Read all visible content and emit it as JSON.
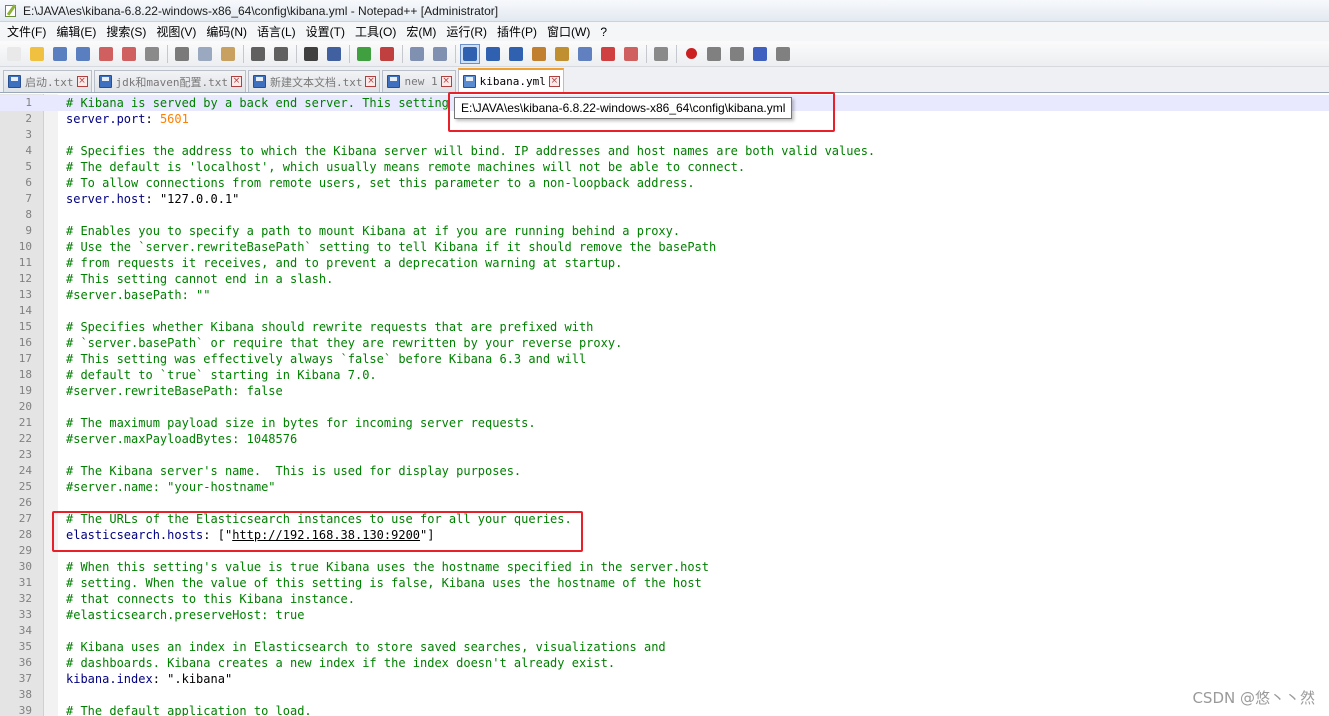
{
  "window": {
    "title": "E:\\JAVA\\es\\kibana-6.8.22-windows-x86_64\\config\\kibana.yml - Notepad++ [Administrator]"
  },
  "menu": [
    "文件(F)",
    "编辑(E)",
    "搜索(S)",
    "视图(V)",
    "编码(N)",
    "语言(L)",
    "设置(T)",
    "工具(O)",
    "宏(M)",
    "运行(R)",
    "插件(P)",
    "窗口(W)",
    "?"
  ],
  "toolbar_icons": [
    {
      "name": "new-file-icon",
      "color": "#e9e9e9"
    },
    {
      "name": "open-file-icon",
      "color": "#f0c040"
    },
    {
      "name": "save-icon",
      "color": "#5a7fc0"
    },
    {
      "name": "save-all-icon",
      "color": "#5a7fc0"
    },
    {
      "name": "close-icon",
      "color": "#d06060"
    },
    {
      "name": "close-all-icon",
      "color": "#d06060"
    },
    {
      "name": "print-icon",
      "color": "#8a8a8a"
    },
    {
      "name": "cut-icon",
      "color": "#7a7a7a"
    },
    {
      "name": "copy-icon",
      "color": "#9aa8c0"
    },
    {
      "name": "paste-icon",
      "color": "#c8a060"
    },
    {
      "name": "undo-icon",
      "color": "#606060"
    },
    {
      "name": "redo-icon",
      "color": "#606060"
    },
    {
      "name": "find-icon",
      "color": "#404040"
    },
    {
      "name": "replace-icon",
      "color": "#4060a0"
    },
    {
      "name": "zoom-in-icon",
      "color": "#40a040"
    },
    {
      "name": "zoom-out-icon",
      "color": "#c04040"
    },
    {
      "name": "sync-vertical-icon",
      "color": "#8090b0"
    },
    {
      "name": "sync-horizontal-icon",
      "color": "#8090b0"
    },
    {
      "name": "word-wrap-icon",
      "color": "#3060b0"
    },
    {
      "name": "show-all-chars-icon",
      "color": "#3060b0"
    },
    {
      "name": "indent-guide-icon",
      "color": "#3060b0"
    },
    {
      "name": "udl-icon",
      "color": "#c08030"
    },
    {
      "name": "doc-map-icon",
      "color": "#c09030"
    },
    {
      "name": "function-list-icon",
      "color": "#6080c0"
    },
    {
      "name": "folder-workspace-icon",
      "color": "#d04040"
    },
    {
      "name": "monitor-icon",
      "color": "#d06060"
    },
    {
      "name": "eye-icon",
      "color": "#8a8a8a"
    },
    {
      "name": "record-macro-icon",
      "color": "#cc2020"
    },
    {
      "name": "stop-macro-icon",
      "color": "#808080"
    },
    {
      "name": "play-macro-icon",
      "color": "#808080"
    },
    {
      "name": "run-macro-multiple-icon",
      "color": "#4060c0"
    },
    {
      "name": "save-macro-icon",
      "color": "#808080"
    }
  ],
  "tabs": [
    {
      "label": "启动.txt",
      "active": false
    },
    {
      "label": "jdk和maven配置.txt",
      "active": false
    },
    {
      "label": "新建文本文档.txt",
      "active": false
    },
    {
      "label": "new 1",
      "active": false
    },
    {
      "label": "kibana.yml",
      "active": true
    }
  ],
  "tooltip": "E:\\JAVA\\es\\kibana-6.8.22-windows-x86_64\\config\\kibana.yml",
  "lines": [
    {
      "n": "1",
      "t": "comment",
      "text": "# Kibana is served by a back end server. This setting specifies the port to use."
    },
    {
      "n": "2",
      "t": "kv",
      "key": "server.port",
      "sep": ": ",
      "val": "5601",
      "vt": "num"
    },
    {
      "n": "3",
      "t": "blank",
      "text": ""
    },
    {
      "n": "4",
      "t": "comment",
      "text": "# Specifies the address to which the Kibana server will bind. IP addresses and host names are both valid values."
    },
    {
      "n": "5",
      "t": "comment",
      "text": "# The default is 'localhost', which usually means remote machines will not be able to connect."
    },
    {
      "n": "6",
      "t": "comment",
      "text": "# To allow connections from remote users, set this parameter to a non-loopback address."
    },
    {
      "n": "7",
      "t": "kv",
      "key": "server.host",
      "sep": ": ",
      "val": "\"127.0.0.1\"",
      "vt": "str"
    },
    {
      "n": "8",
      "t": "blank",
      "text": ""
    },
    {
      "n": "9",
      "t": "comment",
      "text": "# Enables you to specify a path to mount Kibana at if you are running behind a proxy."
    },
    {
      "n": "10",
      "t": "comment",
      "text": "# Use the `server.rewriteBasePath` setting to tell Kibana if it should remove the basePath"
    },
    {
      "n": "11",
      "t": "comment",
      "text": "# from requests it receives, and to prevent a deprecation warning at startup."
    },
    {
      "n": "12",
      "t": "comment",
      "text": "# This setting cannot end in a slash."
    },
    {
      "n": "13",
      "t": "comment",
      "text": "#server.basePath: \"\""
    },
    {
      "n": "14",
      "t": "blank",
      "text": ""
    },
    {
      "n": "15",
      "t": "comment",
      "text": "# Specifies whether Kibana should rewrite requests that are prefixed with"
    },
    {
      "n": "16",
      "t": "comment",
      "text": "# `server.basePath` or require that they are rewritten by your reverse proxy."
    },
    {
      "n": "17",
      "t": "comment",
      "text": "# This setting was effectively always `false` before Kibana 6.3 and will"
    },
    {
      "n": "18",
      "t": "comment",
      "text": "# default to `true` starting in Kibana 7.0."
    },
    {
      "n": "19",
      "t": "comment",
      "text": "#server.rewriteBasePath: false"
    },
    {
      "n": "20",
      "t": "blank",
      "text": ""
    },
    {
      "n": "21",
      "t": "comment",
      "text": "# The maximum payload size in bytes for incoming server requests."
    },
    {
      "n": "22",
      "t": "comment",
      "text": "#server.maxPayloadBytes: 1048576"
    },
    {
      "n": "23",
      "t": "blank",
      "text": ""
    },
    {
      "n": "24",
      "t": "comment",
      "text": "# The Kibana server's name.  This is used for display purposes."
    },
    {
      "n": "25",
      "t": "comment",
      "text": "#server.name: \"your-hostname\""
    },
    {
      "n": "26",
      "t": "blank",
      "text": ""
    },
    {
      "n": "27",
      "t": "comment",
      "text": "# The URLs of the Elasticsearch instances to use for all your queries."
    },
    {
      "n": "28",
      "t": "url",
      "key": "elasticsearch.hosts",
      "sep": ": [\"",
      "val": "http://192.168.38.130:9200",
      "post": "\"]"
    },
    {
      "n": "29",
      "t": "blank",
      "text": ""
    },
    {
      "n": "30",
      "t": "comment",
      "text": "# When this setting's value is true Kibana uses the hostname specified in the server.host"
    },
    {
      "n": "31",
      "t": "comment",
      "text": "# setting. When the value of this setting is false, Kibana uses the hostname of the host"
    },
    {
      "n": "32",
      "t": "comment",
      "text": "# that connects to this Kibana instance."
    },
    {
      "n": "33",
      "t": "comment",
      "text": "#elasticsearch.preserveHost: true"
    },
    {
      "n": "34",
      "t": "blank",
      "text": ""
    },
    {
      "n": "35",
      "t": "comment",
      "text": "# Kibana uses an index in Elasticsearch to store saved searches, visualizations and"
    },
    {
      "n": "36",
      "t": "comment",
      "text": "# dashboards. Kibana creates a new index if the index doesn't already exist."
    },
    {
      "n": "37",
      "t": "kv",
      "key": "kibana.index",
      "sep": ": ",
      "val": "\".kibana\"",
      "vt": "str"
    },
    {
      "n": "38",
      "t": "blank",
      "text": ""
    },
    {
      "n": "39",
      "t": "comment",
      "text": "# The default application to load."
    }
  ],
  "watermark": "CSDN @悠丶丶然",
  "colors": {
    "comment": "#008000",
    "key": "#000080",
    "number": "#ff8000",
    "annotation": "#e8202a",
    "current_line": "#e8e8ff"
  }
}
